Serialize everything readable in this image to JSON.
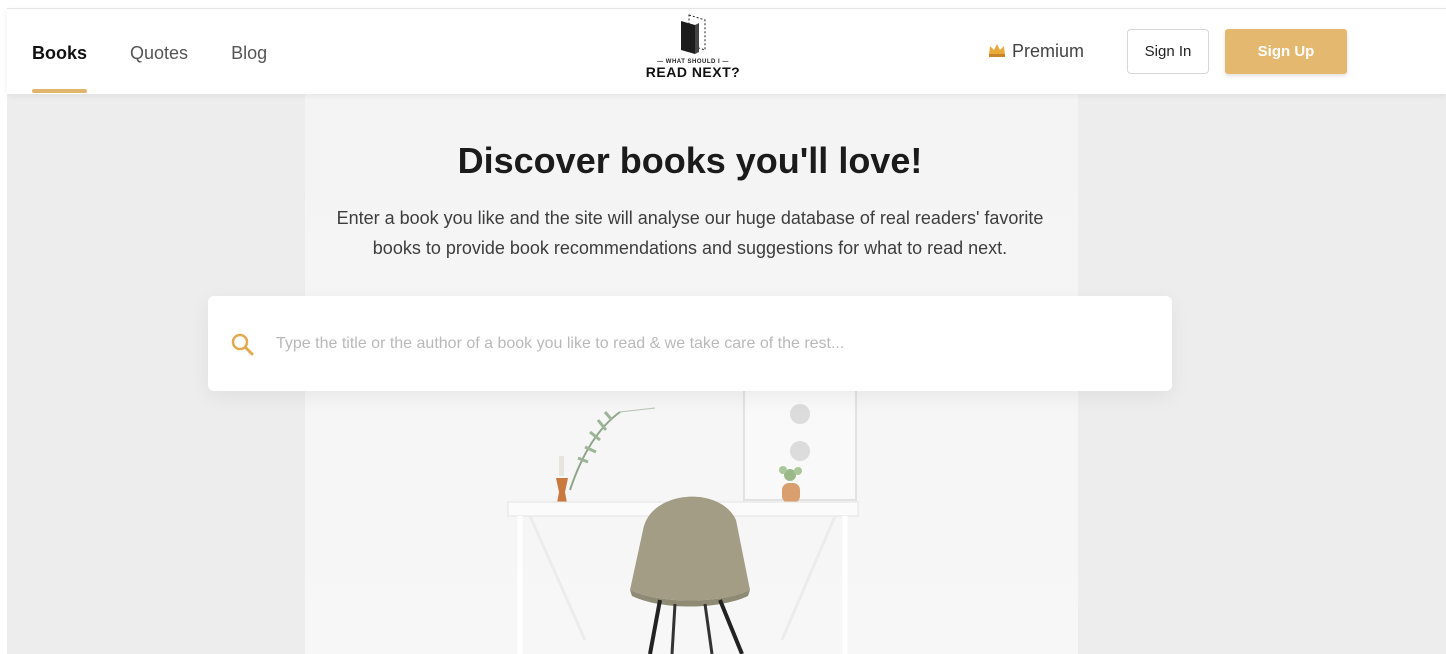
{
  "nav": {
    "items": [
      {
        "label": "Books",
        "active": true
      },
      {
        "label": "Quotes",
        "active": false
      },
      {
        "label": "Blog",
        "active": false
      }
    ]
  },
  "logo": {
    "tagline": "— WHAT SHOULD I —",
    "name": "READ NEXT?"
  },
  "header": {
    "premium_label": "Premium",
    "premium_icon": "crown-icon",
    "signin_label": "Sign In",
    "signup_label": "Sign Up"
  },
  "hero": {
    "title": "Discover books you'll love!",
    "subtitle_line1": "Enter a book you like and the site will analyse our huge database of real readers' favorite",
    "subtitle_line2": "books to provide book recommendations and suggestions for what to read next."
  },
  "search": {
    "placeholder": "Type the title or the author of a book you like to read & we take care of the rest...",
    "value": "",
    "icon": "search-icon"
  },
  "colors": {
    "accent": "#e4b86f",
    "background": "#ededed"
  }
}
